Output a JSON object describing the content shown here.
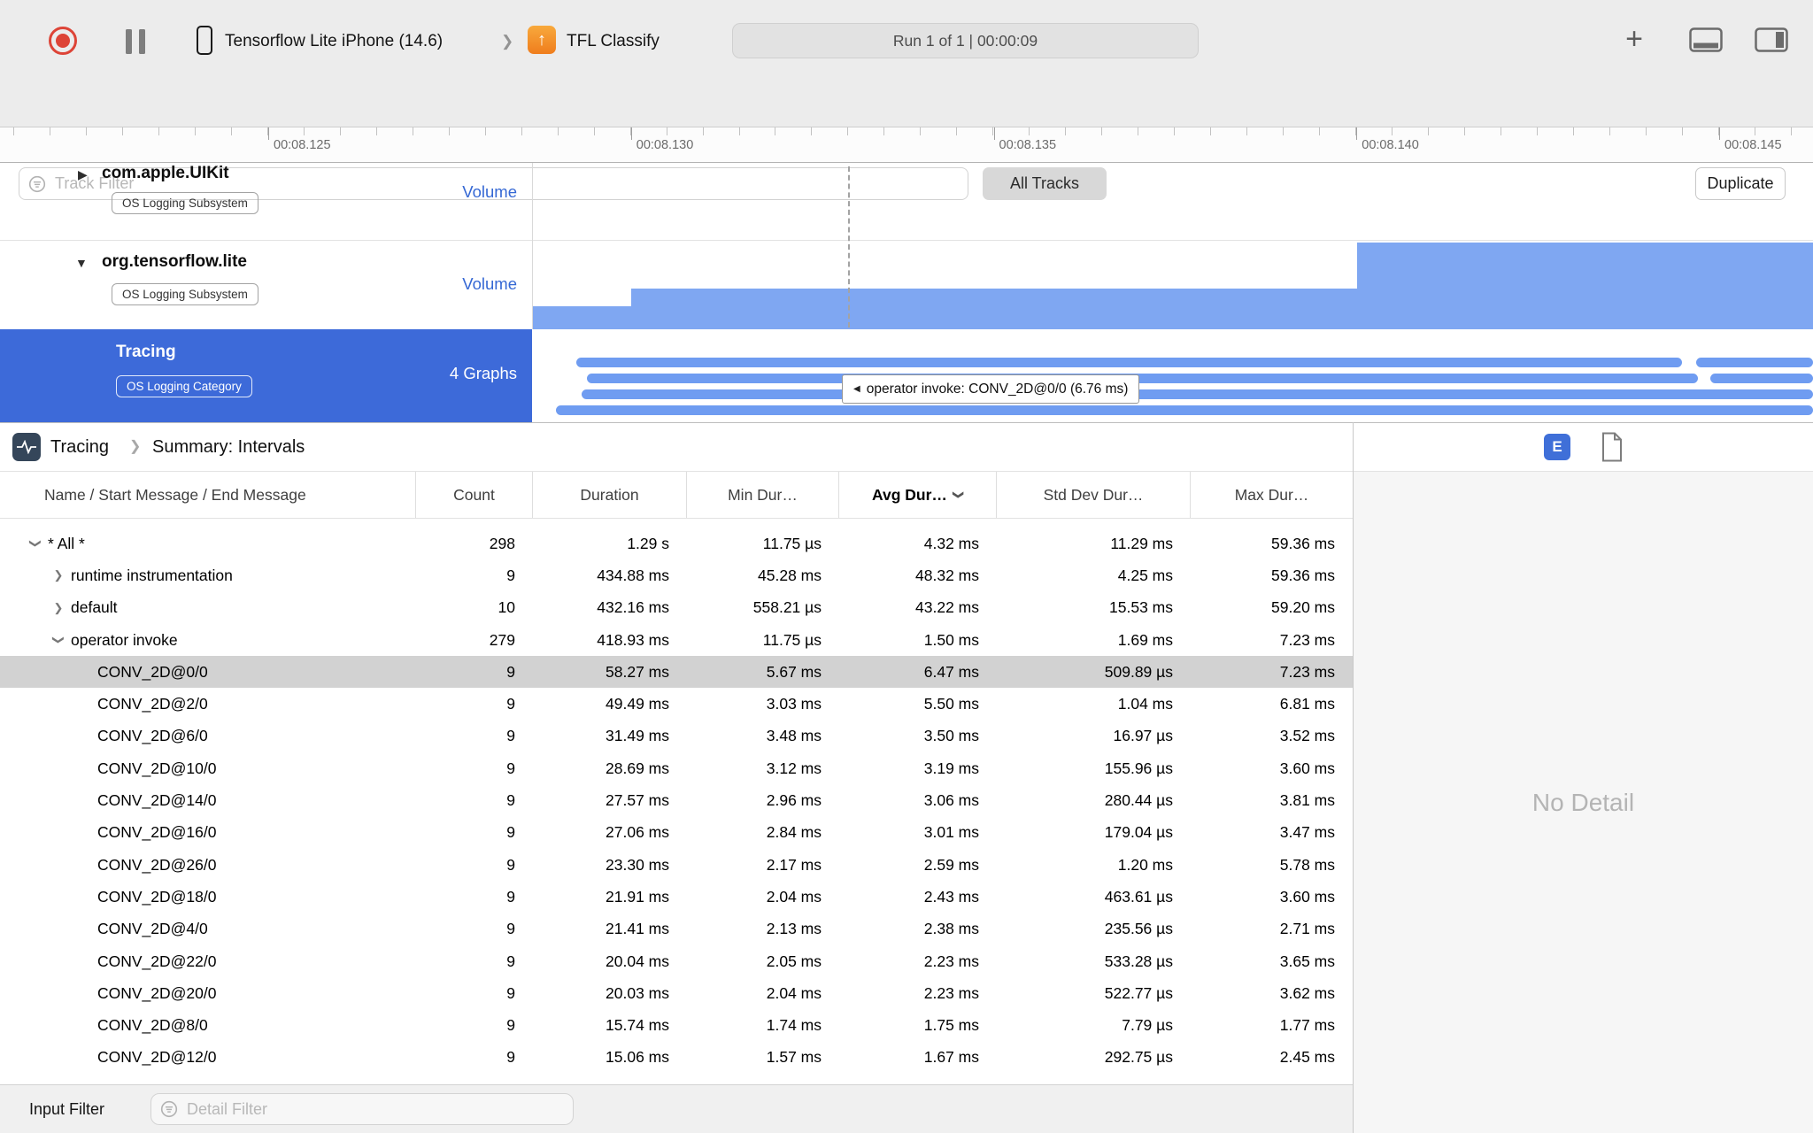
{
  "toolbar": {
    "device_name": "Tensorflow Lite iPhone (14.6)",
    "target_name": "TFL Classify",
    "run_status": "Run 1 of 1  |  00:00:09"
  },
  "filter_bar": {
    "track_filter_placeholder": "Track Filter",
    "all_tracks": "All Tracks",
    "duplicate": "Duplicate"
  },
  "ruler": {
    "labels": [
      "00:08.125",
      "00:08.130",
      "00:08.135",
      "00:08.140",
      "00:08.145"
    ]
  },
  "tracks": {
    "uikit": {
      "name": "com.apple.UIKit",
      "badge": "OS Logging Subsystem",
      "meta": "Volume",
      "disclosure": "collapsed",
      "selected": false
    },
    "tflite": {
      "name": "org.tensorflow.lite",
      "badge": "OS Logging Subsystem",
      "meta": "Volume",
      "disclosure": "expanded",
      "selected": false
    },
    "tracing": {
      "name": "Tracing",
      "badge": "OS Logging Category",
      "meta": "4 Graphs",
      "selected": true
    }
  },
  "timeline": {
    "tooltip": "operator invoke: CONV_2D@0/0 (6.76 ms)"
  },
  "detail_pane": {
    "breadcrumb_root": "Tracing",
    "breadcrumb_page": "Summary: Intervals",
    "e_badge": "E",
    "no_detail": "No Detail"
  },
  "table": {
    "columns": [
      "Name / Start Message / End Message",
      "Count",
      "Duration",
      "Min Dur…",
      "Avg Dur…",
      "Std Dev Dur…",
      "Max Dur…"
    ],
    "sort_column": "Avg Dur…",
    "rows": [
      {
        "name": "* All *",
        "level": 1,
        "disclosure": "expanded",
        "selected": false,
        "count": "298",
        "duration": "1.29 s",
        "min": "11.75 µs",
        "avg": "4.32 ms",
        "std": "11.29 ms",
        "max": "59.36 ms"
      },
      {
        "name": "runtime instrumentation",
        "level": 2,
        "disclosure": "collapsed",
        "selected": false,
        "count": "9",
        "duration": "434.88 ms",
        "min": "45.28 ms",
        "avg": "48.32 ms",
        "std": "4.25 ms",
        "max": "59.36 ms"
      },
      {
        "name": "default",
        "level": 2,
        "disclosure": "collapsed",
        "selected": false,
        "count": "10",
        "duration": "432.16 ms",
        "min": "558.21 µs",
        "avg": "43.22 ms",
        "std": "15.53 ms",
        "max": "59.20 ms"
      },
      {
        "name": "operator invoke",
        "level": 2,
        "disclosure": "expanded",
        "selected": false,
        "count": "279",
        "duration": "418.93 ms",
        "min": "11.75 µs",
        "avg": "1.50 ms",
        "std": "1.69 ms",
        "max": "7.23 ms"
      },
      {
        "name": "CONV_2D@0/0",
        "level": 3,
        "disclosure": null,
        "selected": true,
        "count": "9",
        "duration": "58.27 ms",
        "min": "5.67 ms",
        "avg": "6.47 ms",
        "std": "509.89 µs",
        "max": "7.23 ms"
      },
      {
        "name": "CONV_2D@2/0",
        "level": 3,
        "disclosure": null,
        "selected": false,
        "count": "9",
        "duration": "49.49 ms",
        "min": "3.03 ms",
        "avg": "5.50 ms",
        "std": "1.04 ms",
        "max": "6.81 ms"
      },
      {
        "name": "CONV_2D@6/0",
        "level": 3,
        "disclosure": null,
        "selected": false,
        "count": "9",
        "duration": "31.49 ms",
        "min": "3.48 ms",
        "avg": "3.50 ms",
        "std": "16.97 µs",
        "max": "3.52 ms"
      },
      {
        "name": "CONV_2D@10/0",
        "level": 3,
        "disclosure": null,
        "selected": false,
        "count": "9",
        "duration": "28.69 ms",
        "min": "3.12 ms",
        "avg": "3.19 ms",
        "std": "155.96 µs",
        "max": "3.60 ms"
      },
      {
        "name": "CONV_2D@14/0",
        "level": 3,
        "disclosure": null,
        "selected": false,
        "count": "9",
        "duration": "27.57 ms",
        "min": "2.96 ms",
        "avg": "3.06 ms",
        "std": "280.44 µs",
        "max": "3.81 ms"
      },
      {
        "name": "CONV_2D@16/0",
        "level": 3,
        "disclosure": null,
        "selected": false,
        "count": "9",
        "duration": "27.06 ms",
        "min": "2.84 ms",
        "avg": "3.01 ms",
        "std": "179.04 µs",
        "max": "3.47 ms"
      },
      {
        "name": "CONV_2D@26/0",
        "level": 3,
        "disclosure": null,
        "selected": false,
        "count": "9",
        "duration": "23.30 ms",
        "min": "2.17 ms",
        "avg": "2.59 ms",
        "std": "1.20 ms",
        "max": "5.78 ms"
      },
      {
        "name": "CONV_2D@18/0",
        "level": 3,
        "disclosure": null,
        "selected": false,
        "count": "9",
        "duration": "21.91 ms",
        "min": "2.04 ms",
        "avg": "2.43 ms",
        "std": "463.61 µs",
        "max": "3.60 ms"
      },
      {
        "name": "CONV_2D@4/0",
        "level": 3,
        "disclosure": null,
        "selected": false,
        "count": "9",
        "duration": "21.41 ms",
        "min": "2.13 ms",
        "avg": "2.38 ms",
        "std": "235.56 µs",
        "max": "2.71 ms"
      },
      {
        "name": "CONV_2D@22/0",
        "level": 3,
        "disclosure": null,
        "selected": false,
        "count": "9",
        "duration": "20.04 ms",
        "min": "2.05 ms",
        "avg": "2.23 ms",
        "std": "533.28 µs",
        "max": "3.65 ms"
      },
      {
        "name": "CONV_2D@20/0",
        "level": 3,
        "disclosure": null,
        "selected": false,
        "count": "9",
        "duration": "20.03 ms",
        "min": "2.04 ms",
        "avg": "2.23 ms",
        "std": "522.77 µs",
        "max": "3.62 ms"
      },
      {
        "name": "CONV_2D@8/0",
        "level": 3,
        "disclosure": null,
        "selected": false,
        "count": "9",
        "duration": "15.74 ms",
        "min": "1.74 ms",
        "avg": "1.75 ms",
        "std": "7.79 µs",
        "max": "1.77 ms"
      },
      {
        "name": "CONV_2D@12/0",
        "level": 3,
        "disclosure": null,
        "selected": false,
        "count": "9",
        "duration": "15.06 ms",
        "min": "1.57 ms",
        "avg": "1.67 ms",
        "std": "292.75 µs",
        "max": "2.45 ms"
      }
    ]
  },
  "bottom_bar": {
    "label": "Input Filter",
    "detail_filter_placeholder": "Detail Filter"
  }
}
